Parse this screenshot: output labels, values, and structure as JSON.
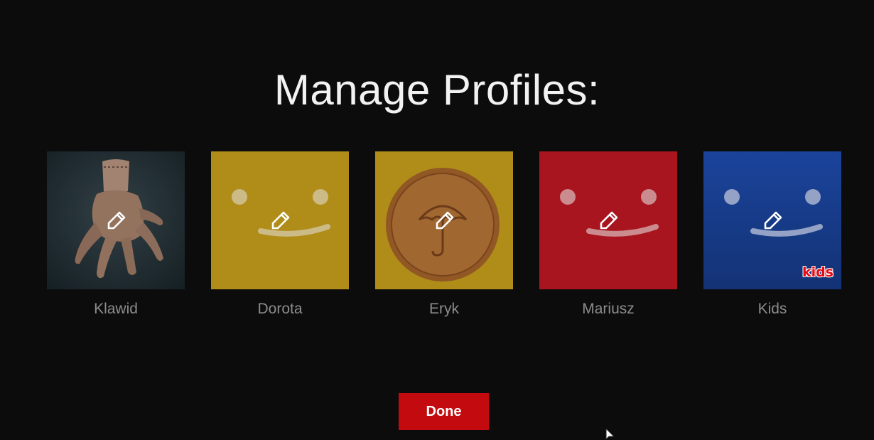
{
  "header": {
    "title": "Manage Profiles:"
  },
  "profiles": [
    {
      "name": "Klawid",
      "avatar": "hand-avatar",
      "color": "#25343a",
      "edit_icon": "pencil-icon"
    },
    {
      "name": "Dorota",
      "avatar": "smiley-avatar",
      "color": "#c9a11c",
      "edit_icon": "pencil-icon"
    },
    {
      "name": "Eryk",
      "avatar": "coin-avatar",
      "color": "#c9a11c",
      "edit_icon": "pencil-icon"
    },
    {
      "name": "Mariusz",
      "avatar": "smiley-avatar",
      "color": "#c01923",
      "edit_icon": "pencil-icon"
    },
    {
      "name": "Kids",
      "avatar": "smiley-avatar",
      "color": "#1f4db1",
      "edit_icon": "pencil-icon",
      "badge": "kids"
    }
  ],
  "actions": {
    "done_label": "Done"
  },
  "colors": {
    "background": "#0c0c0c",
    "accent": "#c30a0f",
    "name_text": "#8c8c8c"
  }
}
